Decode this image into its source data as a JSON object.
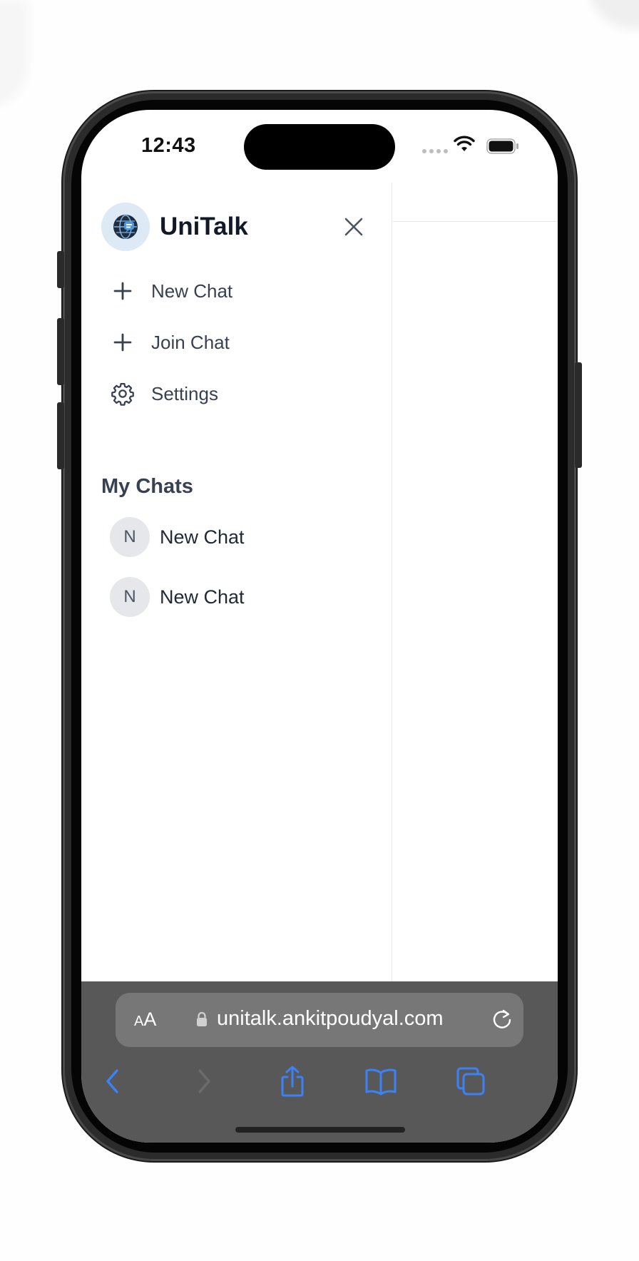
{
  "status_bar": {
    "time": "12:43"
  },
  "sidebar": {
    "app_name": "UniTalk",
    "logo_icon": "globe-chat-icon",
    "menu": [
      {
        "label": "New Chat",
        "icon": "plus-icon"
      },
      {
        "label": "Join Chat",
        "icon": "plus-icon"
      },
      {
        "label": "Settings",
        "icon": "gear-icon"
      }
    ],
    "section_title": "My Chats",
    "chats": [
      {
        "initial": "N",
        "label": "New Chat"
      },
      {
        "initial": "N",
        "label": "New Chat"
      }
    ]
  },
  "browser": {
    "text_size_label_small": "A",
    "text_size_label_big": "A",
    "url": "unitalk.ankitpoudyal.com"
  },
  "colors": {
    "accent_blue": "#3b82f6",
    "safari_bar": "#585858",
    "text_primary": "#111827",
    "text_secondary": "#374151"
  }
}
